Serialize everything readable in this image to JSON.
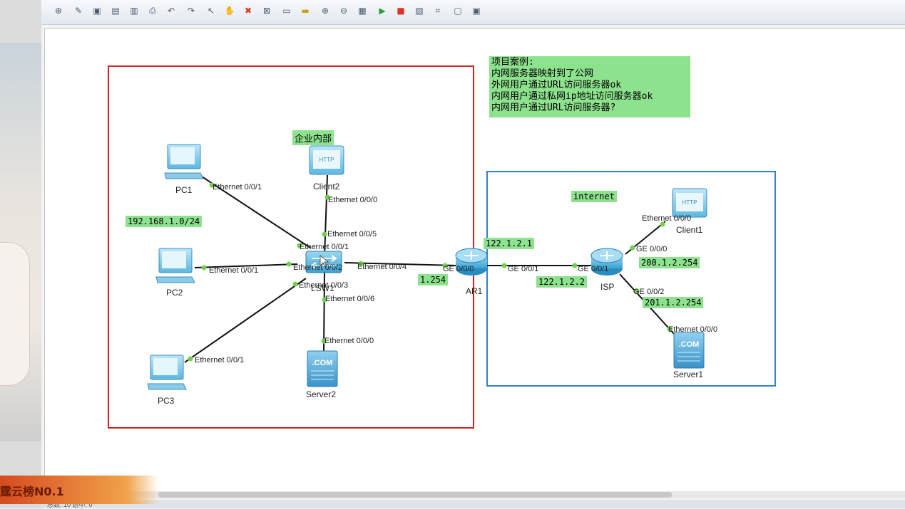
{
  "toolbar": {
    "buttons": [
      "new-topo",
      "new-example",
      "open",
      "save",
      "save-as",
      "print",
      "undo",
      "redo",
      "select",
      "pan",
      "delete",
      "delete-connection",
      "text",
      "palette",
      "zoom-in",
      "zoom-out",
      "fit",
      "start-device",
      "stop-device",
      "capture",
      "cli",
      "settings",
      "fullscreen"
    ]
  },
  "diagram": {
    "zone_internal": {
      "label": "企业内部",
      "border_color": "#d42020"
    },
    "zone_internet": {
      "label": "internet",
      "border_color": "#2f7fd6"
    },
    "notes": {
      "project_title": "项目案例:",
      "project_lines": [
        "内网服务器映射到了公网",
        "外网用户通过URL访问服务器ok",
        "内网用户通过私网ip地址访问服务器ok",
        "内网用户通过URL访问服务器?"
      ],
      "subnet": "192.168.1.0/24",
      "ar1_internal_ip": "1.254",
      "ar1_public_ip": "122.1.2.1",
      "isp_link_ip": "122.1.2.2",
      "isp_client_gw": "200.1.2.254",
      "isp_server_gw": "201.1.2.254"
    },
    "devices": {
      "pc1": "PC1",
      "pc2": "PC2",
      "pc3": "PC3",
      "client2": "Client2",
      "server2": "Server2",
      "lsw1": "LSW1",
      "ar1": "AR1",
      "isp": "ISP",
      "client1": "Client1",
      "server1": "Server1"
    },
    "ports": {
      "pc1_eth": "Ethernet 0/0/1",
      "pc2_eth": "Ethernet 0/0/1",
      "pc3_eth": "Ethernet 0/0/1",
      "client2_eth": "Ethernet 0/0/0",
      "server2_eth": "Ethernet 0/0/0",
      "lsw_e5": "Ethernet 0/0/5",
      "lsw_e1": "Ethernet 0/0/1",
      "lsw_e2": "Ethernet 0/0/2",
      "lsw_e3": "Ethernet 0/0/3",
      "lsw_e4": "Ethernet 0/0/4",
      "lsw_e6": "Ethernet 0/0/6",
      "ar1_ge0": "GE 0/0/0",
      "ar1_ge1": "GE 0/0/1",
      "isp_ge1": "GE 0/0/1",
      "isp_ge0": "GE 0/0/0",
      "isp_ge2": "GE 0/0/2",
      "client1_eth": "Ethernet 0/0/0",
      "server1_eth": "Ethernet 0/0/0"
    }
  },
  "overlay": {
    "banner_text": "霆云榜N0.1"
  },
  "status": {
    "text": "总数: 10 选中: 0"
  },
  "colors": {
    "note_bg": "#8de28d",
    "port_dot": "#6fd24a",
    "link": "#111111"
  }
}
